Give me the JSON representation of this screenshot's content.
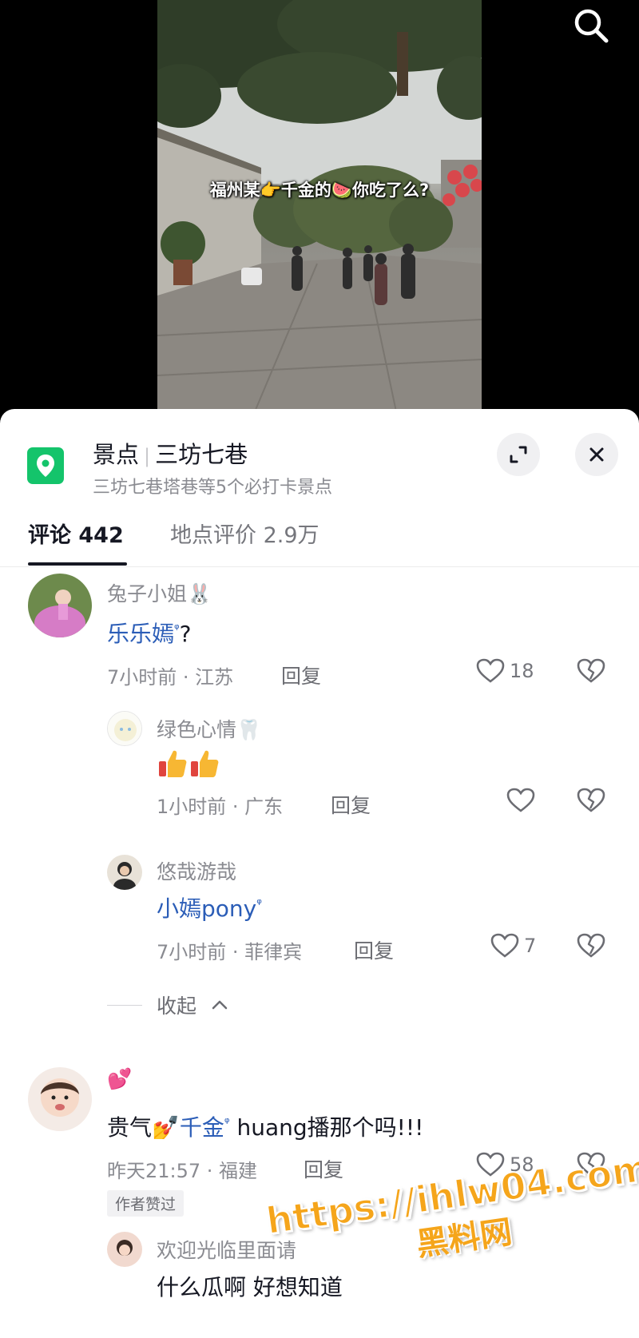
{
  "video": {
    "caption": "福州某👉千金的🍉你吃了么?"
  },
  "top_bar": {
    "search_icon": "search-icon"
  },
  "place": {
    "icon": "location-pin-icon",
    "category": "景点",
    "name": "三坊七巷",
    "subtitle": "三坊七巷塔巷等5个必打卡景点",
    "expand_icon": "expand-icon",
    "close_icon": "close-icon",
    "accent_color": "#14c46b"
  },
  "tabs": [
    {
      "label": "评论 442",
      "active": true
    },
    {
      "label": "地点评价 2.9万",
      "active": false
    }
  ],
  "comments": {
    "c1": {
      "user": "兔子小姐🐰",
      "mention": "乐乐嫣",
      "text": "?",
      "meta": "7小时前 · 江苏",
      "reply": "回复",
      "likes": "18"
    },
    "r1": {
      "user": "绿色心情🦷",
      "text": "👍👍",
      "meta": "1小时前 · 广东",
      "reply": "回复"
    },
    "r2": {
      "user": "悠哉游哉",
      "mention": "小嫣pony",
      "meta": "7小时前 · 菲律宾",
      "reply": "回复",
      "likes": "7"
    },
    "collapse": "收起",
    "c2": {
      "user": "💕",
      "text_before": "贵气💅",
      "mention": "千金",
      "text_after": " huang播那个吗!!!",
      "meta": "昨天21:57 · 福建",
      "reply": "回复",
      "likes": "58",
      "author_tag": "作者赞过"
    },
    "r3": {
      "user": "欢迎光临里面请",
      "text": "什么瓜啊 好想知道"
    },
    "mention_marker": "ᵠ"
  },
  "watermark": {
    "url": "https://ihlw04.com",
    "text": "黑料网"
  }
}
